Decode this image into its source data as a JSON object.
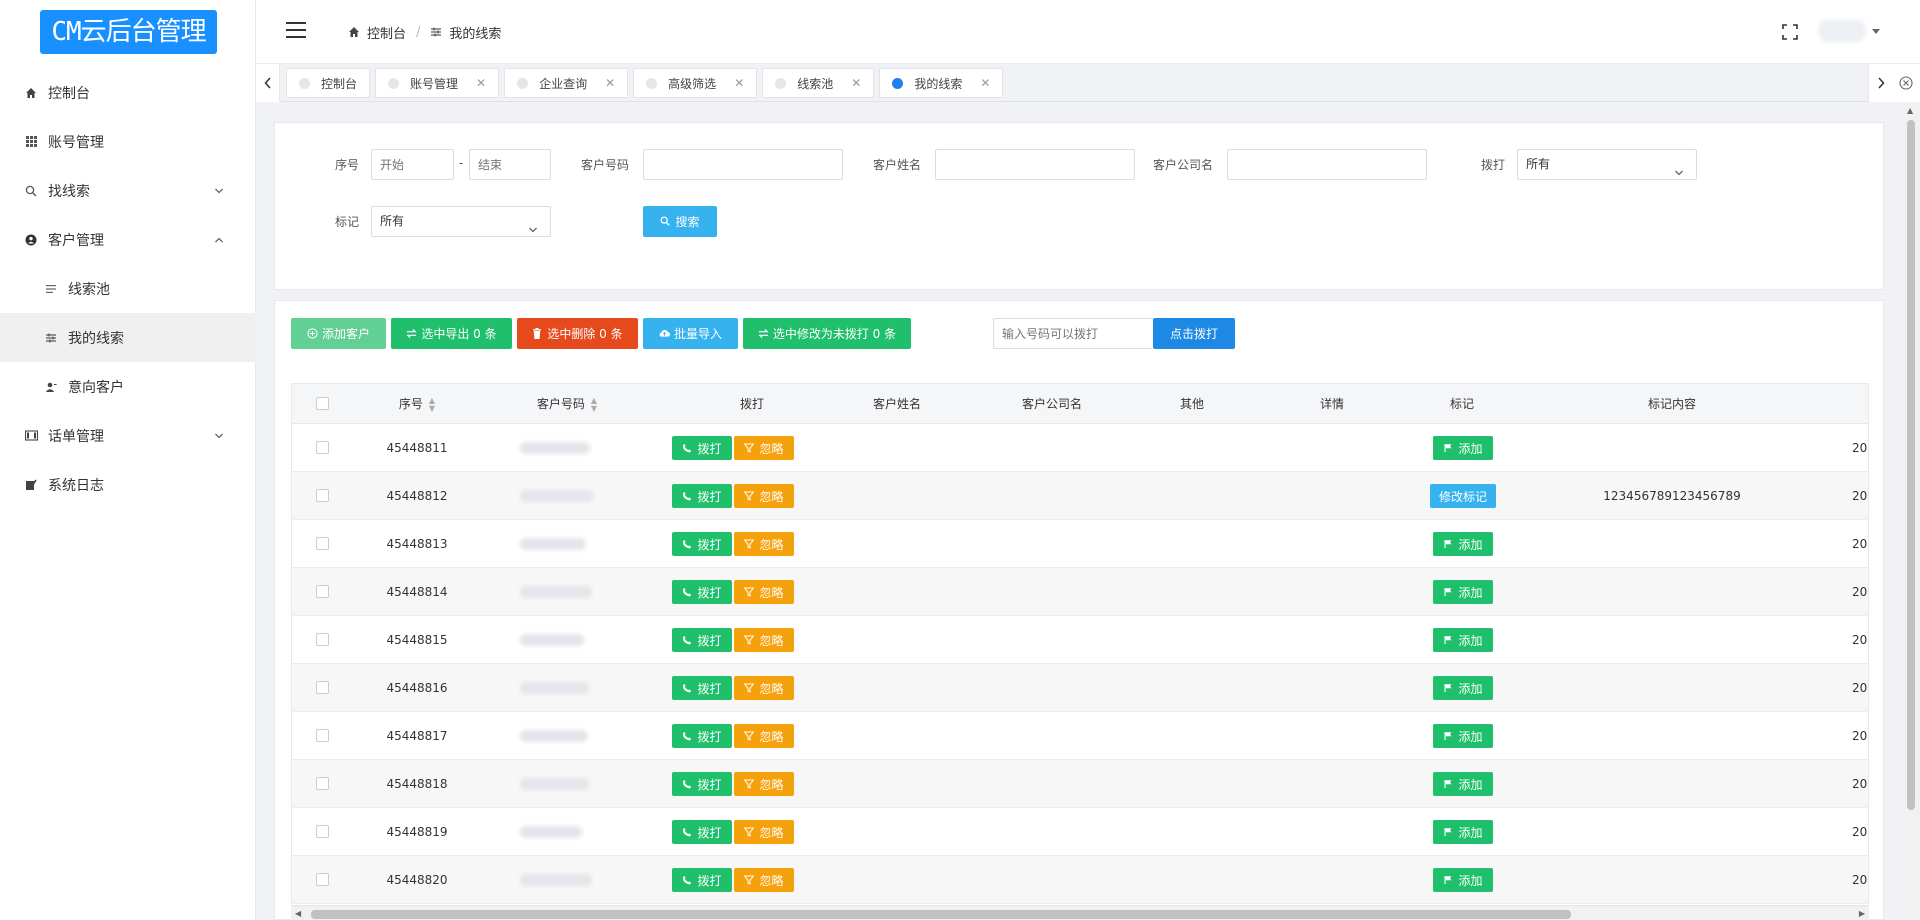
{
  "app": {
    "logo": "CM云后台管理"
  },
  "sidebar": {
    "items": [
      {
        "label": "控制台",
        "icon": "home-icon"
      },
      {
        "label": "账号管理",
        "icon": "grid-icon"
      },
      {
        "label": "找线索",
        "icon": "search-icon",
        "expand": "down"
      },
      {
        "label": "客户管理",
        "icon": "users-icon",
        "expand": "up"
      },
      {
        "label": "线索池",
        "icon": "list-icon"
      },
      {
        "label": "我的线索",
        "icon": "transfer-icon"
      },
      {
        "label": "意向客户",
        "icon": "user-icon"
      },
      {
        "label": "话单管理",
        "icon": "bill-icon",
        "expand": "down"
      },
      {
        "label": "系统日志",
        "icon": "log-icon"
      }
    ]
  },
  "header": {
    "breadcrumb": [
      "控制台",
      "我的线索"
    ]
  },
  "tabs": [
    {
      "label": "控制台"
    },
    {
      "label": "账号管理"
    },
    {
      "label": "企业查询"
    },
    {
      "label": "高级筛选"
    },
    {
      "label": "线索池"
    },
    {
      "label": "我的线索"
    }
  ],
  "filter": {
    "seq_label": "序号",
    "seq_start_placeholder": "开始",
    "seq_dash": "-",
    "seq_end_placeholder": "结束",
    "phone_label": "客户号码",
    "name_label": "客户姓名",
    "company_label": "客户公司名",
    "dial_label": "拨打",
    "dial_value": "所有",
    "mark_label": "标记",
    "mark_value": "所有",
    "search_button": "搜索"
  },
  "toolbar": {
    "add_customer": "添加客户",
    "export_selected": "选中导出 0 条",
    "delete_selected": "选中删除 0 条",
    "batch_import": "批量导入",
    "mark_undialed": "选中修改为未拨打 0 条",
    "dial_placeholder": "输入号码可以拨打",
    "dial_button": "点击拨打"
  },
  "table": {
    "columns": [
      "序号",
      "客户号码",
      "拨打",
      "客户姓名",
      "客户公司名",
      "其他",
      "详情",
      "标记",
      "标记内容"
    ],
    "dial_button": "拨打",
    "ignore_button": "忽略",
    "add_mark_button": "添加",
    "edit_mark_button": "修改标记",
    "overflow_text": "20",
    "rows": [
      {
        "seq": "45448811",
        "mark": "add",
        "mark_content": ""
      },
      {
        "seq": "45448812",
        "mark": "edit",
        "mark_content": "123456789123456789"
      },
      {
        "seq": "45448813",
        "mark": "add",
        "mark_content": ""
      },
      {
        "seq": "45448814",
        "mark": "add",
        "mark_content": ""
      },
      {
        "seq": "45448815",
        "mark": "add",
        "mark_content": ""
      },
      {
        "seq": "45448816",
        "mark": "add",
        "mark_content": ""
      },
      {
        "seq": "45448817",
        "mark": "add",
        "mark_content": ""
      },
      {
        "seq": "45448818",
        "mark": "add",
        "mark_content": ""
      },
      {
        "seq": "45448819",
        "mark": "add",
        "mark_content": ""
      },
      {
        "seq": "45448820",
        "mark": "add",
        "mark_content": ""
      }
    ]
  },
  "colors": {
    "primary": "#1890ff",
    "green": "#1fbf6c",
    "red": "#e6491b",
    "cyan": "#36b3ee",
    "orange": "#f5a10b",
    "active_tab_dot": "#1e7ef2"
  }
}
